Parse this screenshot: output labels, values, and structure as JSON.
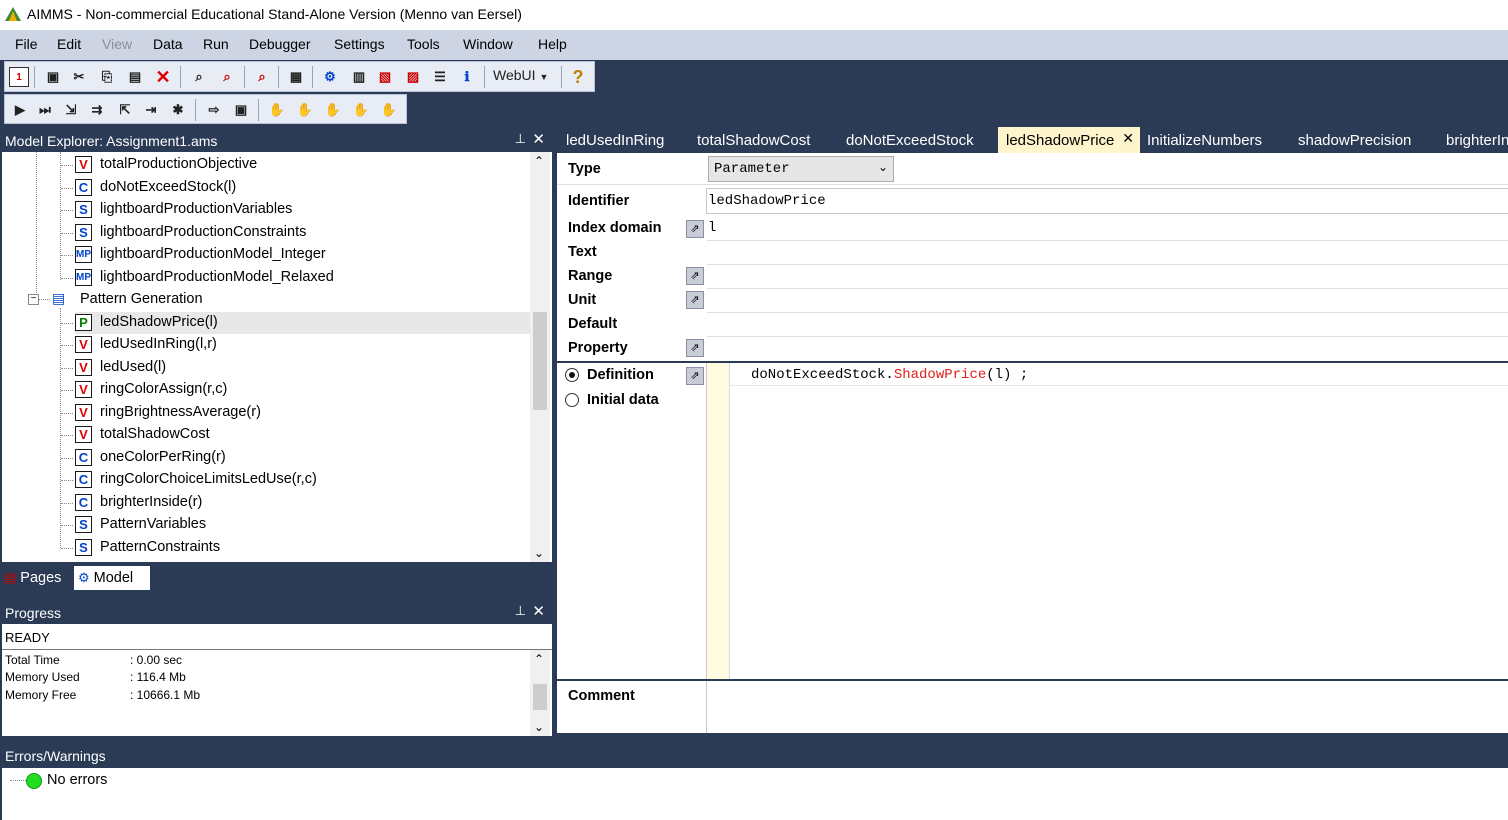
{
  "window": {
    "title": "AIMMS - Non-commercial Educational Stand-Alone Version (Menno van Eersel)"
  },
  "menu": [
    "File",
    "Edit",
    "View",
    "Data",
    "Run",
    "Debugger",
    "Settings",
    "Tools",
    "Window",
    "Help"
  ],
  "toolbar": {
    "webui_label": "WebUI"
  },
  "model_explorer": {
    "title": "Model Explorer: Assignment1.ams",
    "items": [
      {
        "icon": "V",
        "label": "totalProductionObjective"
      },
      {
        "icon": "C",
        "label": "doNotExceedStock(l)"
      },
      {
        "icon": "S",
        "label": "lightboardProductionVariables"
      },
      {
        "icon": "S",
        "label": "lightboardProductionConstraints"
      },
      {
        "icon": "MP",
        "label": "lightboardProductionModel_Integer"
      },
      {
        "icon": "MP",
        "label": "lightboardProductionModel_Relaxed"
      },
      {
        "icon": "section",
        "label": "Pattern Generation"
      },
      {
        "icon": "P",
        "label": "ledShadowPrice(l)"
      },
      {
        "icon": "V",
        "label": "ledUsedInRing(l,r)"
      },
      {
        "icon": "V",
        "label": "ledUsed(l)"
      },
      {
        "icon": "V",
        "label": "ringColorAssign(r,c)"
      },
      {
        "icon": "V",
        "label": "ringBrightnessAverage(r)"
      },
      {
        "icon": "V",
        "label": "totalShadowCost"
      },
      {
        "icon": "C",
        "label": "oneColorPerRing(r)"
      },
      {
        "icon": "C",
        "label": "ringColorChoiceLimitsLedUse(r,c)"
      },
      {
        "icon": "C",
        "label": "brighterInside(r)"
      },
      {
        "icon": "S",
        "label": "PatternVariables"
      },
      {
        "icon": "S",
        "label": "PatternConstraints"
      }
    ],
    "tabs": {
      "pages": "Pages",
      "model": "Model"
    }
  },
  "progress": {
    "title": "Progress",
    "status": "READY",
    "rows": [
      {
        "label": "Total Time",
        "value": ": 0.00 sec"
      },
      {
        "label": "Memory Used",
        "value": ": 116.4 Mb"
      },
      {
        "label": "Memory Free",
        "value": ": 10666.1 Mb"
      }
    ]
  },
  "errors": {
    "title": "Errors/Warnings",
    "message": "No errors"
  },
  "editor": {
    "tabs": [
      "ledUsedInRing",
      "totalShadowCost",
      "doNotExceedStock",
      "ledShadowPrice",
      "InitializeNumbers",
      "shadowPrecision",
      "brighterIn"
    ],
    "active_tab": "ledShadowPrice",
    "attributes": {
      "type_label": "Type",
      "type_value": "Parameter",
      "identifier_label": "Identifier",
      "identifier_value": "ledShadowPrice",
      "index_domain_label": "Index domain",
      "index_domain_value": "l",
      "text_label": "Text",
      "range_label": "Range",
      "unit_label": "Unit",
      "default_label": "Default",
      "property_label": "Property",
      "definition_label": "Definition",
      "initial_data_label": "Initial data",
      "definition_code_prefix": "doNotExceedStock.",
      "definition_code_func": "ShadowPrice",
      "definition_code_suffix": "(l) ;",
      "comment_label": "Comment"
    }
  },
  "colors": {
    "dark_panel": "#2b3a55",
    "menu_bg": "#cdd4e4",
    "active_tab": "#fff5cc",
    "variable_red": "#e00000",
    "constraint_blue": "#0044cc",
    "keyword_red": "#e0201a"
  }
}
